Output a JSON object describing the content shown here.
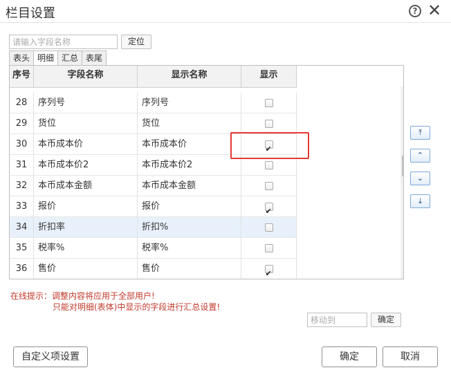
{
  "window": {
    "title": "栏目设置",
    "help_icon": "?",
    "close_icon": "✕"
  },
  "search": {
    "placeholder": "请输入字段名称",
    "locate_label": "定位"
  },
  "tabs": [
    {
      "label": "表头"
    },
    {
      "label": "明细"
    },
    {
      "label": "汇总"
    },
    {
      "label": "表尾"
    }
  ],
  "grid": {
    "headers": {
      "idx": "序号",
      "field_name": "字段名称",
      "display_name": "显示名称",
      "show": "显示"
    },
    "rows": [
      {
        "idx": "28",
        "field_name": "序列号",
        "display_name": "序列号",
        "show": false
      },
      {
        "idx": "29",
        "field_name": "货位",
        "display_name": "货位",
        "show": false
      },
      {
        "idx": "30",
        "field_name": "本币成本价",
        "display_name": "本币成本价",
        "show": true
      },
      {
        "idx": "31",
        "field_name": "本币成本价2",
        "display_name": "本币成本价2",
        "show": false
      },
      {
        "idx": "32",
        "field_name": "本币成本金额",
        "display_name": "本币成本金额",
        "show": false
      },
      {
        "idx": "33",
        "field_name": "报价",
        "display_name": "报价",
        "show": true
      },
      {
        "idx": "34",
        "field_name": "折扣率",
        "display_name": "折扣%",
        "show": false,
        "selected": true
      },
      {
        "idx": "35",
        "field_name": "税率%",
        "display_name": "税率%",
        "show": false
      },
      {
        "idx": "36",
        "field_name": "售价",
        "display_name": "售价",
        "show": true
      }
    ]
  },
  "move_buttons": {
    "top": "⤒",
    "up": "⌃",
    "down": "⌄",
    "bottom": "⤓"
  },
  "hint": {
    "line1": "在线提示：调整内容将应用于全部用户!",
    "line2": "只能对明细(表体)中显示的字段进行汇总设置!"
  },
  "move_to": {
    "placeholder": "移动到",
    "confirm_label": "确定"
  },
  "footer": {
    "custom_label": "自定义项设置",
    "ok_label": "确定",
    "cancel_label": "取消"
  }
}
